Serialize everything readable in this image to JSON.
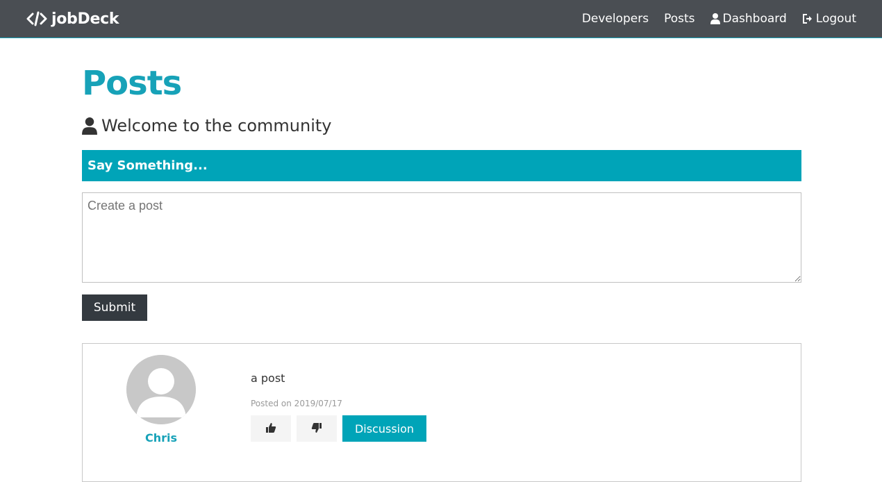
{
  "navbar": {
    "brand": "jobDeck",
    "links": [
      {
        "label": "Developers"
      },
      {
        "label": "Posts"
      },
      {
        "label": "Dashboard",
        "icon": "user-icon"
      },
      {
        "label": "Logout",
        "icon": "sign-out-icon"
      }
    ]
  },
  "page": {
    "title": "Posts",
    "lead": "Welcome to the community",
    "lead_icon": "user-icon"
  },
  "form": {
    "header": "Say Something...",
    "textarea_placeholder": "Create a post",
    "submit_label": "Submit"
  },
  "posts": [
    {
      "author": "Chris",
      "text": "a post",
      "date": "Posted on 2019/07/17",
      "like_icon": "thumbs-up-icon",
      "dislike_icon": "thumbs-down-icon",
      "discussion_label": "Discussion"
    }
  ],
  "colors": {
    "navbar_bg": "#4a4e53",
    "accent": "#17a2b8",
    "say_bar": "#00a4b8",
    "dark_button": "#343a40"
  }
}
